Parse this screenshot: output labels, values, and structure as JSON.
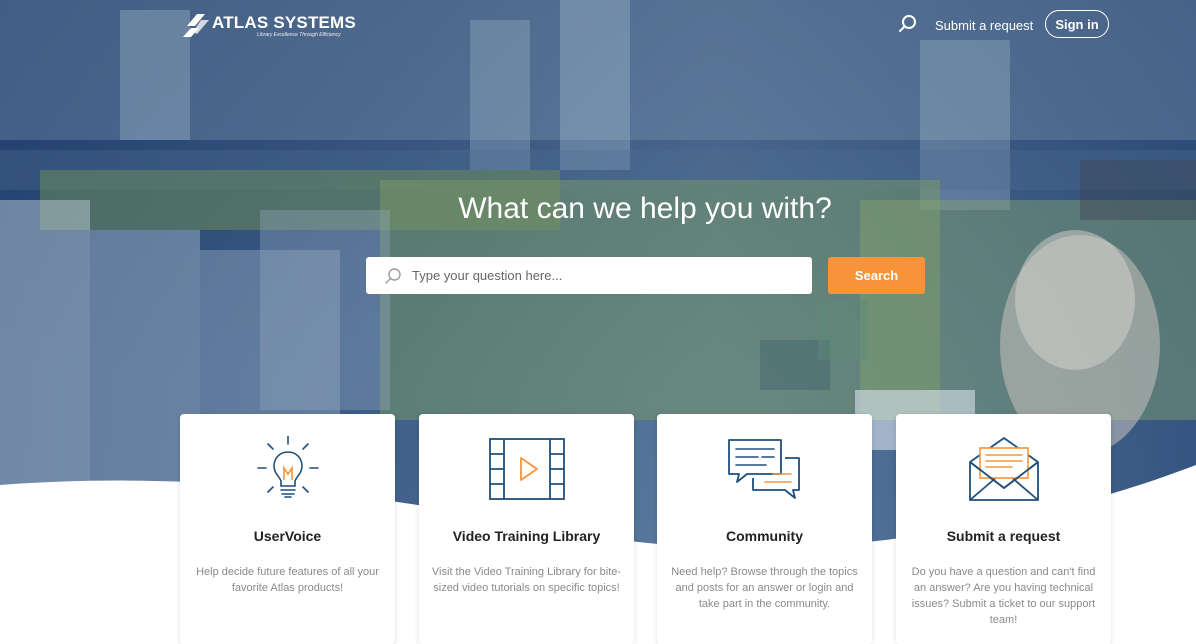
{
  "header": {
    "logo_text": "ATLAS SYSTEMS",
    "logo_tagline": "Library Excellence Through Efficiency",
    "search_icon": "search-icon",
    "submit_request_label": "Submit a request",
    "sign_in_label": "Sign in"
  },
  "hero": {
    "title": "What can we help you with?",
    "search": {
      "placeholder": "Type your question here...",
      "value": "",
      "button_label": "Search"
    }
  },
  "cards": [
    {
      "icon": "lightbulb-icon",
      "title": "UserVoice",
      "description": "Help decide future features of all your favorite Atlas products!"
    },
    {
      "icon": "video-play-icon",
      "title": "Video Training Library",
      "description": "Visit the Video Training Library for bite-sized video tutorials on specific topics!"
    },
    {
      "icon": "chat-bubbles-icon",
      "title": "Community",
      "description": "Need help? Browse through the topics and posts for an answer or login and take part in the community."
    },
    {
      "icon": "envelope-letter-icon",
      "title": "Submit a request",
      "description": "Do you have a question and can't find an answer? Are you having technical issues? Submit a ticket to our support team!"
    }
  ],
  "colors": {
    "accent_orange": "#f7943a",
    "icon_blue": "#1f4f7a",
    "hero_overlay": "#2b4a78",
    "card_text": "#8a8a8a"
  }
}
